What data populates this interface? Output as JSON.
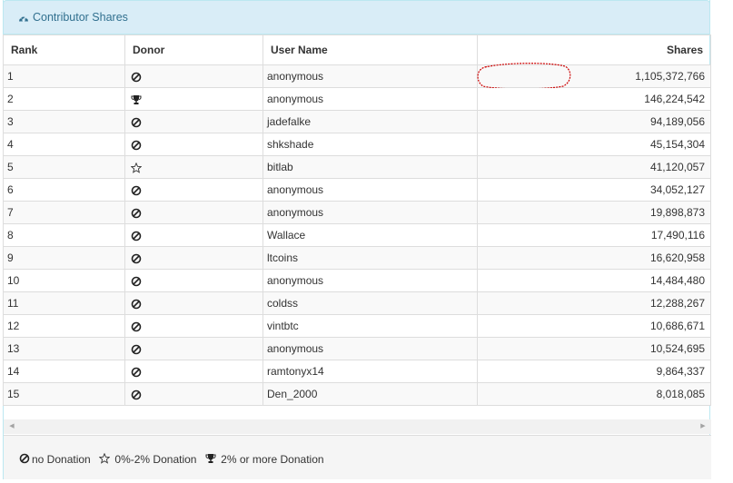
{
  "panel": {
    "title": "Contributor Shares",
    "title_icon": "dashboard-icon"
  },
  "table": {
    "headers": {
      "rank": "Rank",
      "donor": "Donor",
      "user": "User Name",
      "shares": "Shares"
    },
    "rows": [
      {
        "rank": "1",
        "donor": "none",
        "user": "anonymous",
        "shares": "1,105,372,766"
      },
      {
        "rank": "2",
        "donor": "trophy",
        "user": "anonymous",
        "shares": "146,224,542"
      },
      {
        "rank": "3",
        "donor": "none",
        "user": "jadefalke",
        "shares": "94,189,056"
      },
      {
        "rank": "4",
        "donor": "none",
        "user": "shkshade",
        "shares": "45,154,304"
      },
      {
        "rank": "5",
        "donor": "star",
        "user": "bitlab",
        "shares": "41,120,057"
      },
      {
        "rank": "6",
        "donor": "none",
        "user": "anonymous",
        "shares": "34,052,127"
      },
      {
        "rank": "7",
        "donor": "none",
        "user": "anonymous",
        "shares": "19,898,873"
      },
      {
        "rank": "8",
        "donor": "none",
        "user": "Wallace",
        "shares": "17,490,116"
      },
      {
        "rank": "9",
        "donor": "none",
        "user": "ltcoins",
        "shares": "16,620,958"
      },
      {
        "rank": "10",
        "donor": "none",
        "user": "anonymous",
        "shares": "14,484,480"
      },
      {
        "rank": "11",
        "donor": "none",
        "user": "coldss",
        "shares": "12,288,267"
      },
      {
        "rank": "12",
        "donor": "none",
        "user": "vintbtc",
        "shares": "10,686,671"
      },
      {
        "rank": "13",
        "donor": "none",
        "user": "anonymous",
        "shares": "10,524,695"
      },
      {
        "rank": "14",
        "donor": "none",
        "user": "ramtonyx14",
        "shares": "9,864,337"
      },
      {
        "rank": "15",
        "donor": "none",
        "user": "Den_2000",
        "shares": "8,018,085"
      }
    ]
  },
  "legend": {
    "none": "no Donation",
    "star": "0%-2% Donation",
    "trophy": "2% or more Donation"
  },
  "colors": {
    "heading_bg": "#d9edf7",
    "heading_text": "#31708f",
    "highlight_circle": "#cc0000"
  }
}
